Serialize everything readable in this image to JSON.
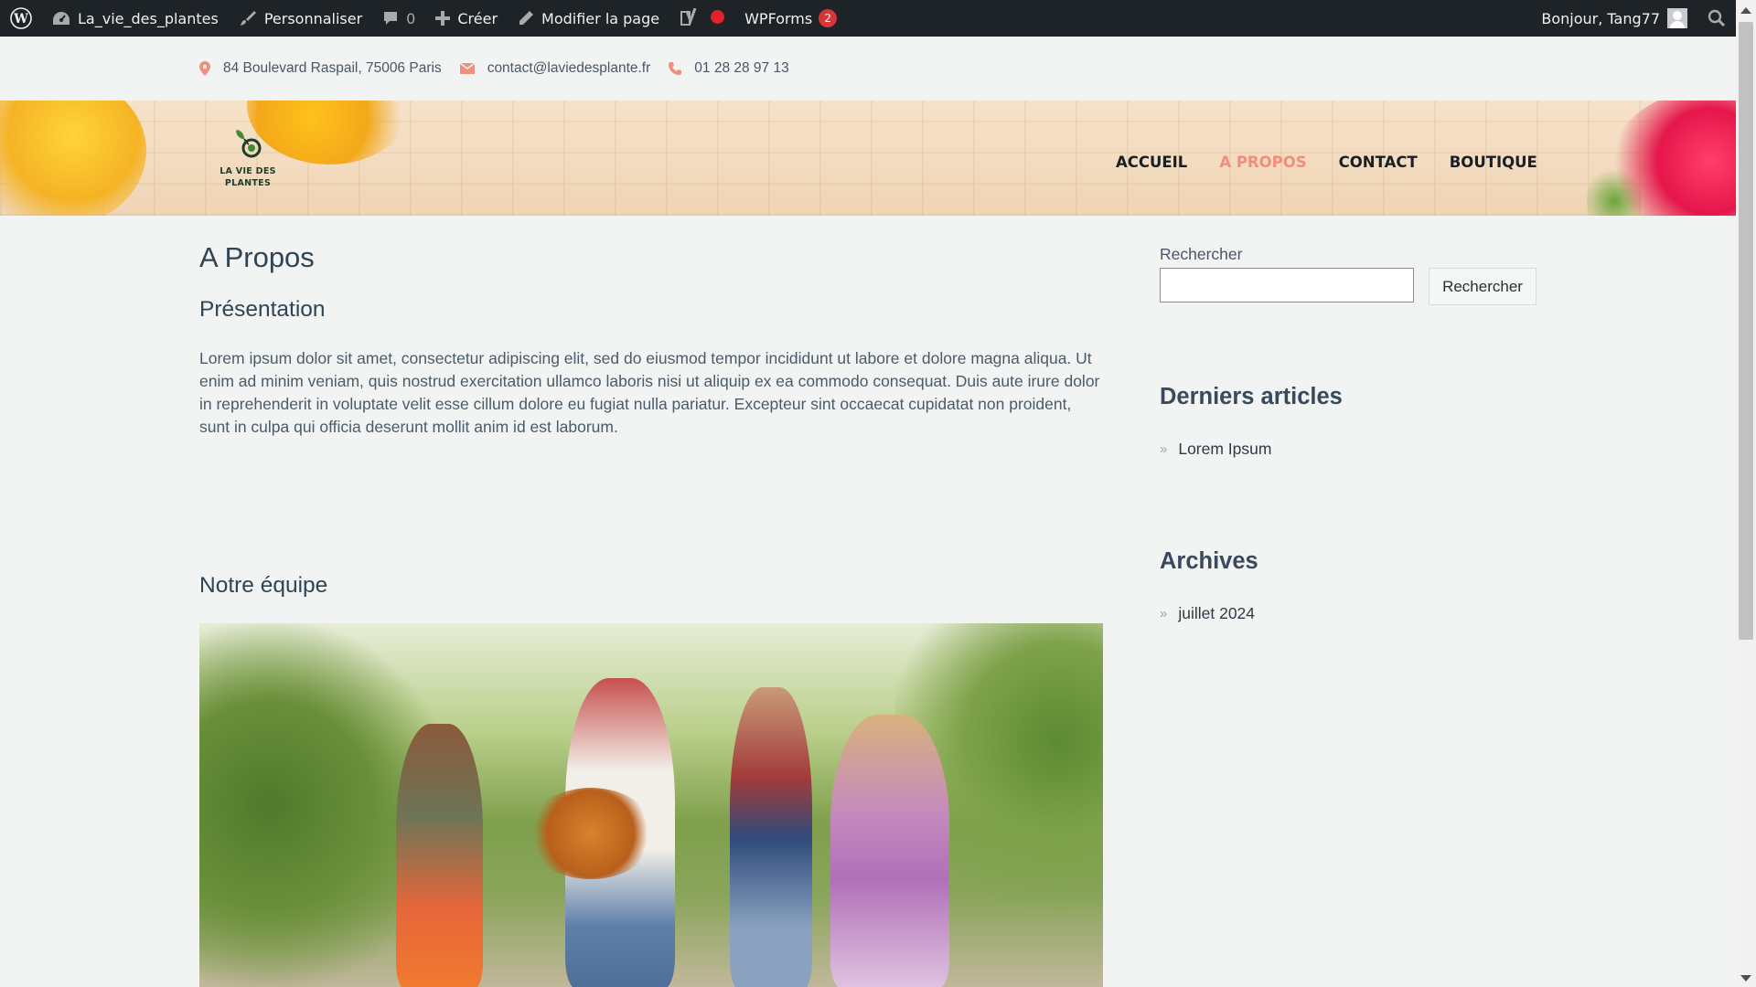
{
  "admin_bar": {
    "site_name": "La_vie_des_plantes",
    "customize": "Personnaliser",
    "comments_count": "0",
    "create": "Créer",
    "edit_page": "Modifier la page",
    "wpforms": "WPForms",
    "wpforms_count": "2",
    "greeting": "Bonjour, Tang77"
  },
  "contact_bar": {
    "address": "84 Boulevard Raspail, 75006 Paris",
    "email": "contact@laviedesplante.fr",
    "phone": "01 28 28 97 13"
  },
  "header": {
    "logo_line1": "LA VIE DES",
    "logo_line2": "PLANTES",
    "nav": [
      "ACCUEIL",
      "A PROPOS",
      "CONTACT",
      "BOUTIQUE"
    ],
    "active_nav": "A PROPOS",
    "active_color": "#ef8f7e"
  },
  "main": {
    "title": "A Propos",
    "presentation_heading": "Présentation",
    "presentation_text": "Lorem ipsum dolor sit amet, consectetur adipiscing elit, sed do eiusmod tempor incididunt ut labore et dolore magna aliqua. Ut enim ad minim veniam, quis nostrud exercitation ullamco laboris nisi ut aliquip ex ea commodo consequat. Duis aute irure dolor in reprehenderit in voluptate velit esse cillum dolore eu fugiat nulla pariatur. Excepteur sint occaecat cupidatat non proident, sunt in culpa qui officia deserunt mollit anim id est laborum.",
    "team_heading": "Notre équipe"
  },
  "sidebar": {
    "search_label": "Rechercher",
    "search_value": "",
    "search_button": "Rechercher",
    "recent_title": "Derniers articles",
    "recent_items": [
      "Lorem Ipsum"
    ],
    "archives_title": "Archives",
    "archive_items": [
      "juillet 2024"
    ]
  }
}
